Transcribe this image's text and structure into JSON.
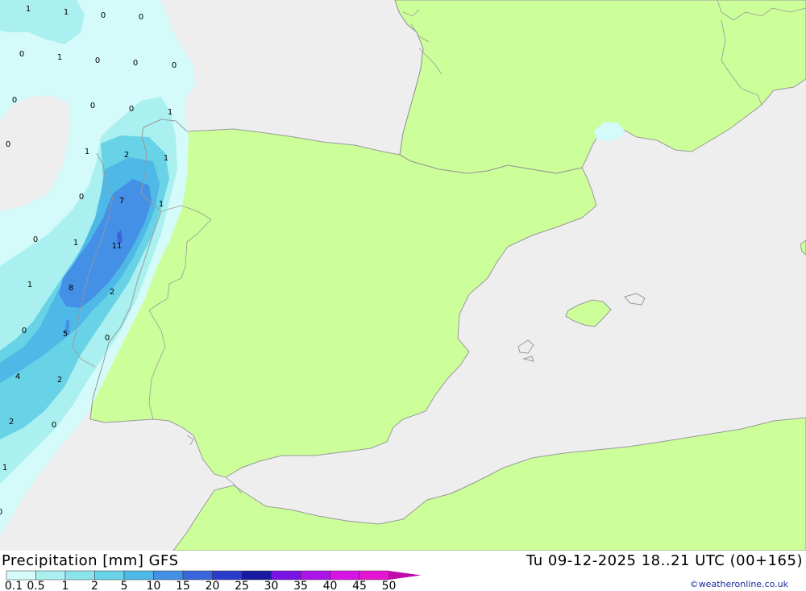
{
  "title": {
    "label": "Precipitation [mm]",
    "model": "GFS",
    "datetime": "Tu 09-12-2025 18..21 UTC (00+165)"
  },
  "credit": "©weatheronline.co.uk",
  "legend": {
    "levels": [
      "0.1",
      "0.5",
      "1",
      "2",
      "5",
      "10",
      "15",
      "20",
      "25",
      "30",
      "35",
      "40",
      "45",
      "50"
    ],
    "colors": [
      "#d4fafa",
      "#aaf0f0",
      "#8ae4ea",
      "#68d2e6",
      "#4eb8e6",
      "#4490e6",
      "#3a66dc",
      "#2a3ccc",
      "#1a1aa0",
      "#7a12e6",
      "#aa14e6",
      "#d614e6",
      "#e614d2",
      "#c00aaa"
    ]
  },
  "map_colors": {
    "sea": "#eeeeee",
    "land": "#ccff99",
    "coast": "#999999"
  },
  "grid_values": [
    {
      "text": "1"
    },
    {
      "text": "1"
    },
    {
      "text": "0"
    },
    {
      "text": "0"
    },
    {
      "text": "0"
    },
    {
      "text": "1"
    },
    {
      "text": "0"
    },
    {
      "text": "0"
    },
    {
      "text": "0"
    },
    {
      "text": "0"
    },
    {
      "text": "0"
    },
    {
      "text": "0"
    },
    {
      "text": "1"
    },
    {
      "text": "0"
    },
    {
      "text": "1"
    },
    {
      "text": "2"
    },
    {
      "text": "1"
    },
    {
      "text": "0"
    },
    {
      "text": "7"
    },
    {
      "text": "1"
    },
    {
      "text": "0"
    },
    {
      "text": "1"
    },
    {
      "text": "11"
    },
    {
      "text": "1"
    },
    {
      "text": "8"
    },
    {
      "text": "2"
    },
    {
      "text": "0"
    },
    {
      "text": "5"
    },
    {
      "text": "0"
    },
    {
      "text": "4"
    },
    {
      "text": "2"
    },
    {
      "text": "2"
    },
    {
      "text": "0"
    },
    {
      "text": "1"
    },
    {
      "text": "0"
    }
  ]
}
